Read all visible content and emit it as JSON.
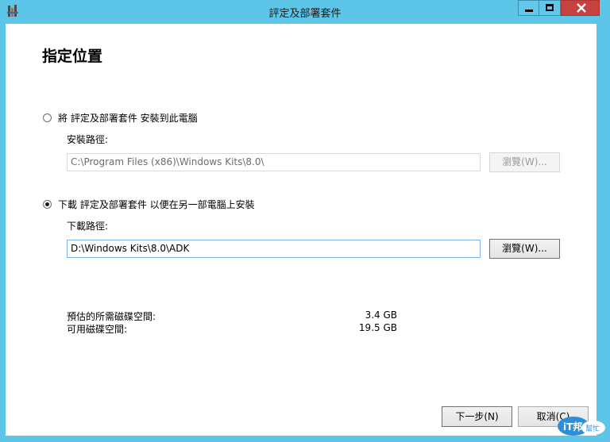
{
  "window": {
    "title": "評定及部署套件"
  },
  "page": {
    "heading": "指定位置"
  },
  "options": [
    {
      "label": "將 評定及部署套件 安裝到此電腦",
      "checked": false,
      "path_label": "安裝路徑:",
      "path_value": "C:\\Program Files (x86)\\Windows Kits\\8.0\\",
      "browse": "瀏覽(W)...",
      "enabled": false
    },
    {
      "label": "下載 評定及部署套件 以便在另一部電腦上安裝",
      "checked": true,
      "path_label": "下載路徑:",
      "path_value": "D:\\Windows Kits\\8.0\\ADK",
      "browse": "瀏覽(W)...",
      "enabled": true
    }
  ],
  "space": {
    "estimated_label": "預估的所需磁碟空間:",
    "estimated_value": "3.4 GB",
    "available_label": "可用磁碟空間:",
    "available_value": "19.5 GB"
  },
  "footer": {
    "next": "下一步(N)",
    "cancel": "取消(C)"
  },
  "watermark": {
    "line1": "iT邦",
    "line2": "幫忙"
  },
  "colors": {
    "titlebar": "#5dc6e8",
    "close": "#c7423f",
    "client": "#ffffff"
  }
}
